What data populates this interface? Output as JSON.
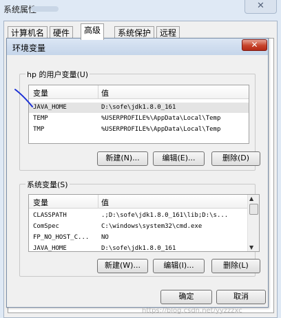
{
  "background_window": {
    "title": "系统属性",
    "close_label": "✕",
    "tabs": [
      "计算机名",
      "硬件",
      "高级",
      "系统保护",
      "远程"
    ]
  },
  "dialog": {
    "title": "环境变量",
    "close_label": "✕",
    "user_section": {
      "label": "hp 的用户变量(U)",
      "columns": [
        "变量",
        "值"
      ],
      "rows": [
        {
          "name": "JAVA_HOME",
          "value": "D:\\sofe\\jdk1.8.0_161"
        },
        {
          "name": "TEMP",
          "value": "%USERPROFILE%\\AppData\\Local\\Temp"
        },
        {
          "name": "TMP",
          "value": "%USERPROFILE%\\AppData\\Local\\Temp"
        }
      ],
      "buttons": {
        "new": "新建(N)...",
        "edit": "编辑(E)...",
        "delete": "删除(D)"
      }
    },
    "system_section": {
      "label": "系统变量(S)",
      "columns": [
        "变量",
        "值"
      ],
      "rows": [
        {
          "name": "CLASSPATH",
          "value": ".;D:\\sofe\\jdk1.8.0_161\\lib;D:\\s..."
        },
        {
          "name": "ComSpec",
          "value": "C:\\windows\\system32\\cmd.exe"
        },
        {
          "name": "FP_NO_HOST_C...",
          "value": "NO"
        },
        {
          "name": "JAVA_HOME",
          "value": "D:\\sofe\\jdk1.8.0_161"
        }
      ],
      "buttons": {
        "new": "新建(W)...",
        "edit": "编辑(I)...",
        "delete": "删除(L)"
      }
    },
    "ok_label": "确定",
    "cancel_label": "取消"
  },
  "watermark": "https://blog.csdn.net/yyzzzxc",
  "icons": {
    "close": "close-icon",
    "scroll_up": "scroll-up-icon",
    "scroll_down": "scroll-down-icon"
  },
  "colors": {
    "annotation": "#1a2fd6",
    "close_button": "#c7432a"
  }
}
